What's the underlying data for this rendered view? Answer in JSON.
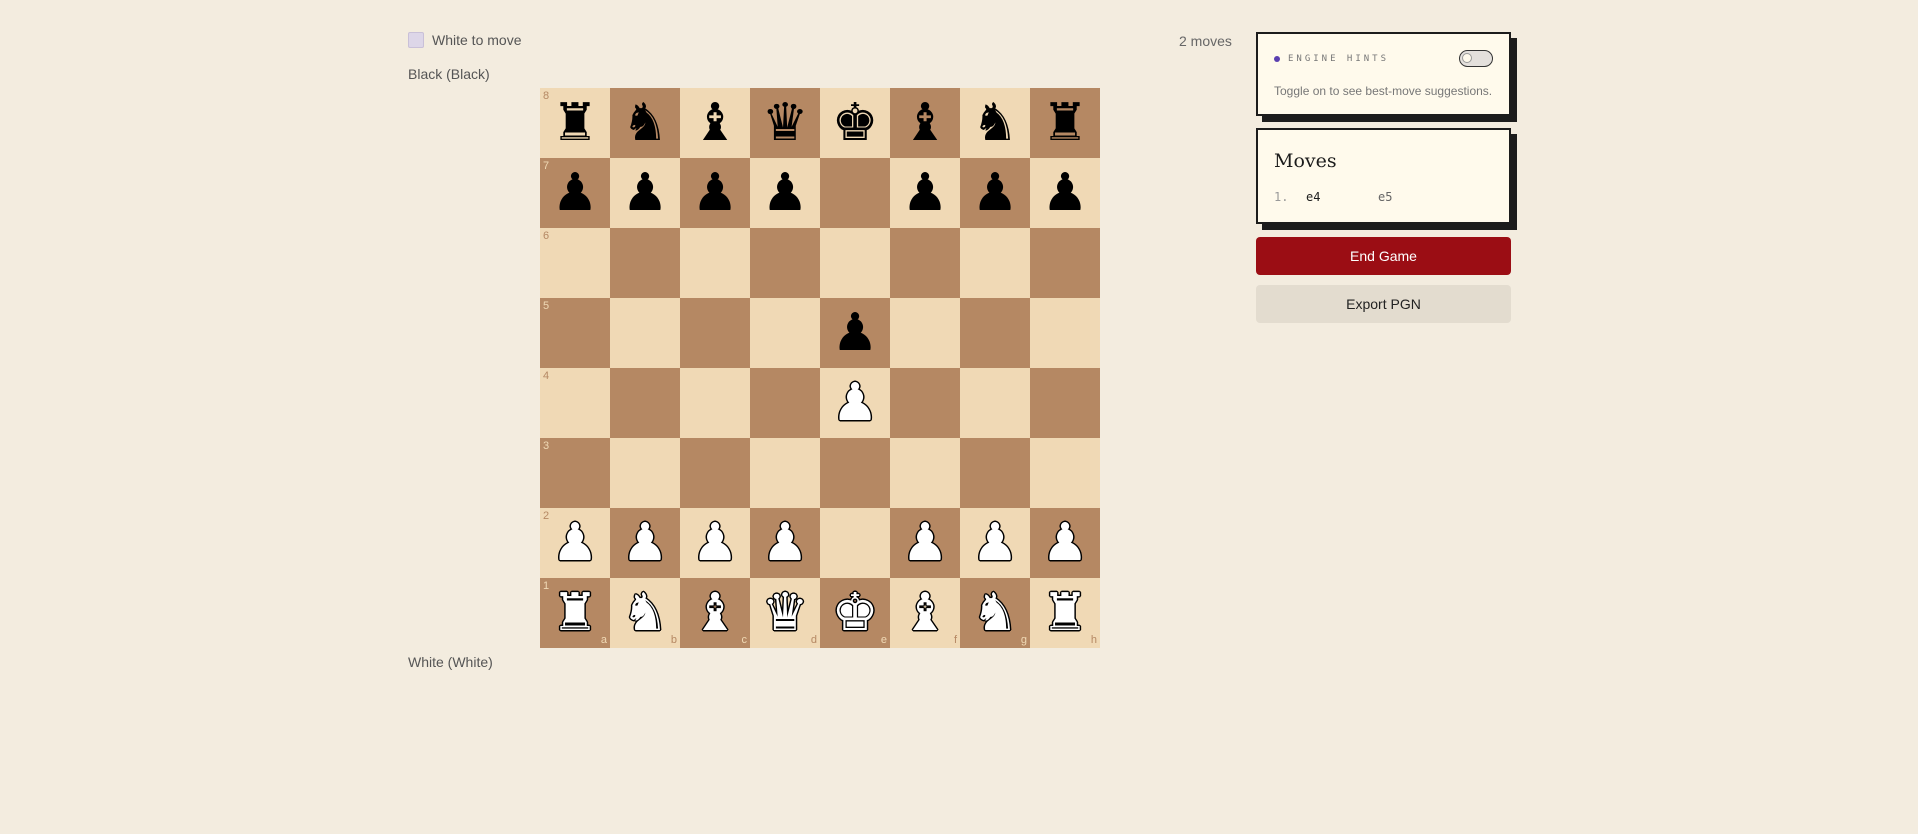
{
  "status": {
    "turn_text": "White to move",
    "move_count": "2 moves"
  },
  "players": {
    "top": "Black (Black)",
    "bottom": "White (White)"
  },
  "board": {
    "files": [
      "a",
      "b",
      "c",
      "d",
      "e",
      "f",
      "g",
      "h"
    ],
    "ranks": [
      "8",
      "7",
      "6",
      "5",
      "4",
      "3",
      "2",
      "1"
    ],
    "position": [
      [
        "bR",
        "bN",
        "bB",
        "bQ",
        "bK",
        "bB",
        "bN",
        "bR"
      ],
      [
        "bP",
        "bP",
        "bP",
        "bP",
        "",
        "bP",
        "bP",
        "bP"
      ],
      [
        "",
        "",
        "",
        "",
        "",
        "",
        "",
        ""
      ],
      [
        "",
        "",
        "",
        "",
        "bP",
        "",
        "",
        ""
      ],
      [
        "",
        "",
        "",
        "",
        "wP",
        "",
        "",
        ""
      ],
      [
        "",
        "",
        "",
        "",
        "",
        "",
        "",
        ""
      ],
      [
        "wP",
        "wP",
        "wP",
        "wP",
        "",
        "wP",
        "wP",
        "wP"
      ],
      [
        "wR",
        "wN",
        "wB",
        "wQ",
        "wK",
        "wB",
        "wN",
        "wR"
      ]
    ],
    "light_color": "#f0d9b5",
    "dark_color": "#b58863"
  },
  "engine_hints": {
    "title": "ENGINE HINTS",
    "description": "Toggle on to see best-move suggestions.",
    "enabled": false
  },
  "moves_panel": {
    "title": "Moves",
    "moves": [
      {
        "number": "1.",
        "white": "e4",
        "black": "e5"
      }
    ]
  },
  "buttons": {
    "end_game": "End Game",
    "export_pgn": "Export PGN"
  },
  "colors": {
    "accent_red": "#9b0d14",
    "hint_dot": "#5a3fb0"
  }
}
